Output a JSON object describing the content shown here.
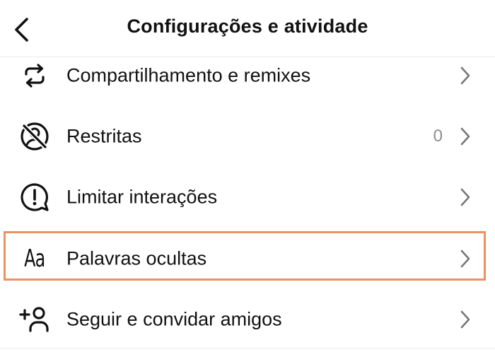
{
  "header": {
    "title": "Configurações e atividade",
    "back_icon": "chevron-left-icon"
  },
  "items": [
    {
      "label": "Compartilhamento e remixes",
      "icon": "repost-arrows-icon",
      "count": ""
    },
    {
      "label": "Restritas",
      "icon": "restricted-user-icon",
      "count": "0"
    },
    {
      "label": "Limitar interações",
      "icon": "limit-interactions-icon",
      "count": ""
    },
    {
      "label": "Palavras ocultas",
      "icon": "aa-text-icon",
      "icon_text": "Aa",
      "count": ""
    },
    {
      "label": "Seguir e convidar amigos",
      "icon": "add-person-icon",
      "count": ""
    }
  ],
  "highlight": {
    "item": "Palavras ocultas",
    "color": "#ee9060"
  },
  "colors": {
    "text": "#111111",
    "muted": "#8e8e8e",
    "divider": "#ececec"
  }
}
